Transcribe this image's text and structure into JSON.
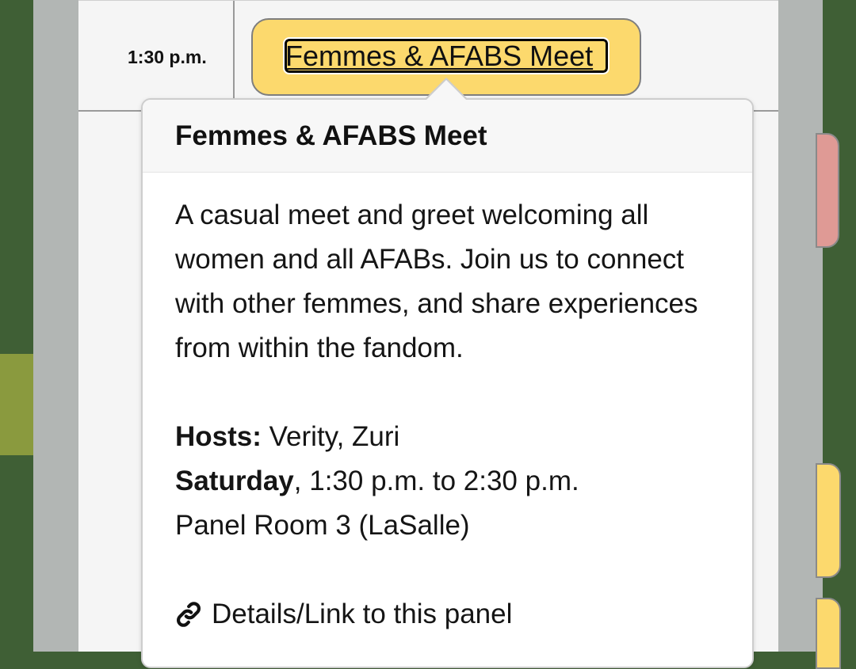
{
  "schedule": {
    "time_label": "1:30 p.m.",
    "event_chip_label": "Femmes & AFABS Meet"
  },
  "popover": {
    "title": "Femmes & AFABS Meet",
    "description": "A casual meet and greet welcoming all women and all AFABs. Join us to connect with other femmes, and share experiences from within the fandom.",
    "hosts_label": "Hosts:",
    "hosts_value": "Verity, Zuri",
    "day_label": "Saturday",
    "time_range": ", 1:30 p.m. to 2:30 p.m.",
    "room": "Panel Room 3 (LaSalle)",
    "link_text": "Details/Link to this panel",
    "link_icon": "link-icon"
  },
  "colors": {
    "event_yellow": "#fcd96d",
    "event_red": "#df9a95",
    "background_green": "#3f5f35"
  }
}
